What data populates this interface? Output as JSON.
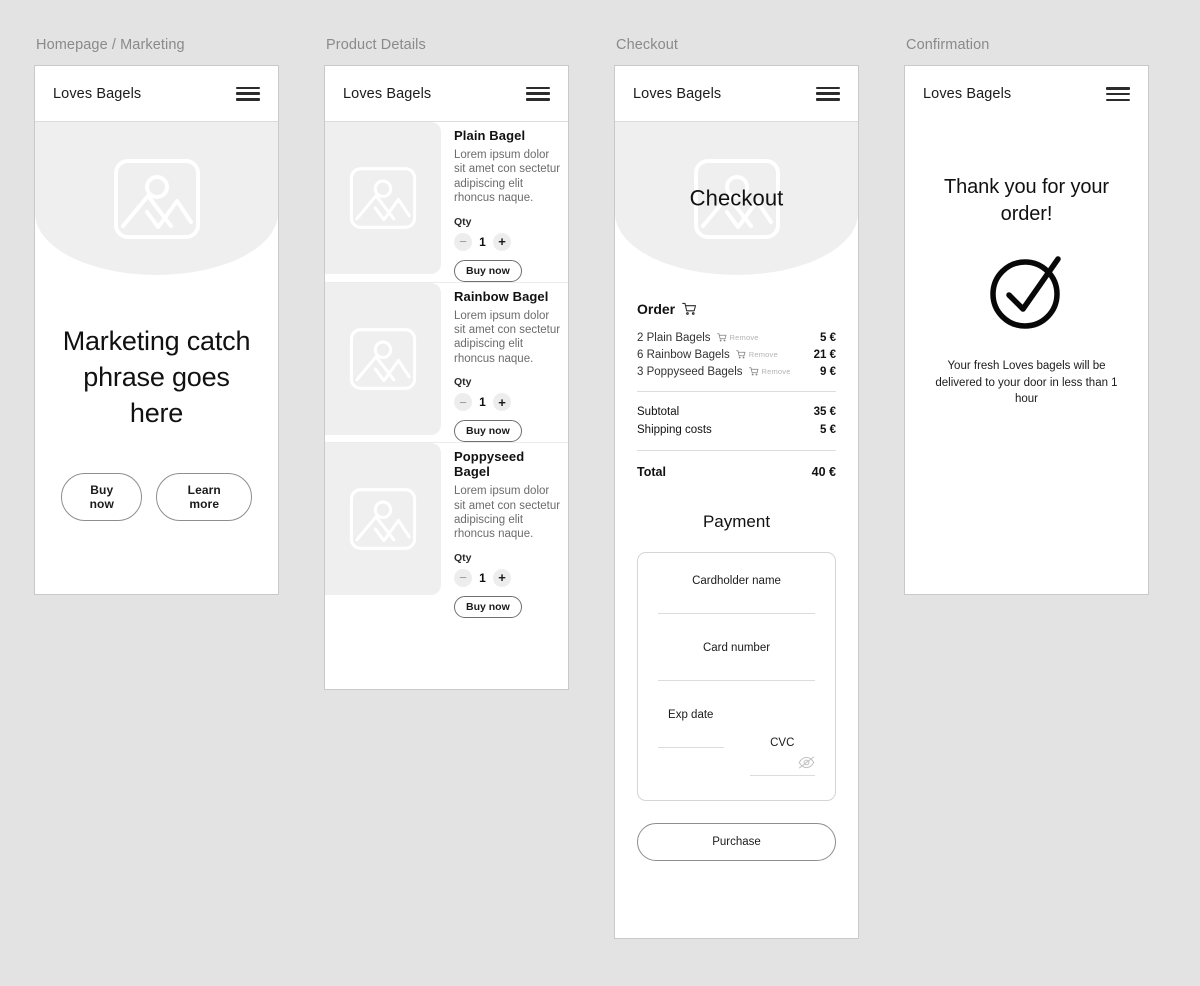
{
  "background_color": "#e3e3e3",
  "frames": [
    {
      "label": "Homepage / Marketing"
    },
    {
      "label": "Product Details"
    },
    {
      "label": "Checkout"
    },
    {
      "label": "Confirmation"
    }
  ],
  "brand": "Loves Bagels",
  "icons": {
    "menu": "hamburger-menu-icon",
    "image_placeholder": "image-placeholder-icon",
    "cart": "shopping-cart-icon",
    "eye_off": "eye-off-icon",
    "check_circle": "check-circle-icon"
  },
  "marketing": {
    "headline": "Marketing catch phrase goes here",
    "primary_button": "Buy now",
    "secondary_button": "Learn more"
  },
  "products": {
    "qty_label": "Qty",
    "buy_label": "Buy now",
    "decrement_label": "−",
    "increment_label": "+",
    "items": [
      {
        "title": "Plain Bagel",
        "description": "Lorem ipsum dolor sit amet con sectetur adipiscing elit rhoncus naque.",
        "qty": "1"
      },
      {
        "title": "Rainbow Bagel",
        "description": "Lorem ipsum dolor sit amet con sectetur adipiscing elit rhoncus naque.",
        "qty": "1"
      },
      {
        "title": "Poppyseed Bagel",
        "description": "Lorem ipsum dolor sit amet con sectetur adipiscing elit rhoncus naque.",
        "qty": "1"
      }
    ]
  },
  "checkout": {
    "hero_text": "Checkout",
    "order_title": "Order",
    "remove_label": "Remove",
    "lines": [
      {
        "name": "2 Plain Bagels",
        "price": "5 €"
      },
      {
        "name": "6 Rainbow Bagels",
        "price": "21 €"
      },
      {
        "name": "3 Poppyseed Bagels",
        "price": "9 €"
      }
    ],
    "subtotal_label": "Subtotal",
    "subtotal_value": "35 €",
    "shipping_label": "Shipping costs",
    "shipping_value": "5 €",
    "total_label": "Total",
    "total_value": "40 €",
    "payment_title": "Payment",
    "fields": {
      "cardholder": "Cardholder name",
      "card_number": "Card number",
      "exp_date": "Exp date",
      "cvc": "CVC"
    },
    "purchase_button": "Purchase"
  },
  "confirmation": {
    "headline": "Thank you for your order!",
    "message": "Your fresh Loves bagels will be delivered to your door in less than 1 hour"
  }
}
